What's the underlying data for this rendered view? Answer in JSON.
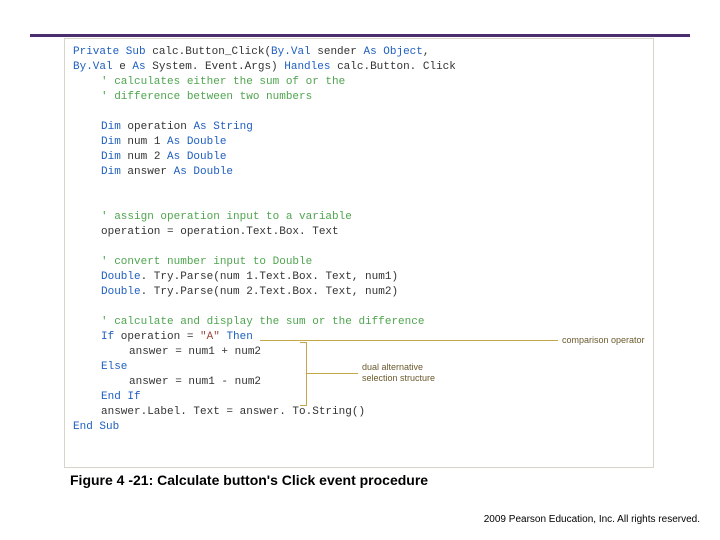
{
  "accent_color": "#4b2e6f",
  "code": {
    "l1a": "Private Sub",
    "l1b": " calc.Button_Click(",
    "l1c": "By.Val",
    "l1d": " sender ",
    "l1e": "As Object",
    "l1f": ",",
    "l2a": "By.Val",
    "l2b": " e ",
    "l2c": "As",
    "l2d": " System. Event.Args) ",
    "l2e": "Handles",
    "l2f": " calc.Button. Click",
    "c1": "' calculates either the sum of or the",
    "c2": "' difference between two numbers",
    "d1a": "Dim",
    "d1b": " operation ",
    "d1c": "As String",
    "d2a": "Dim",
    "d2b": " num 1 ",
    "d2c": "As Double",
    "d3a": "Dim",
    "d3b": " num 2 ",
    "d3c": "As Double",
    "d4a": "Dim",
    "d4b": " answer ",
    "d4c": "As Double",
    "c3": "' assign operation input to a variable",
    "s1": "operation = operation.Text.Box. Text",
    "c4": "' convert number input to Double",
    "s2a": "Double",
    "s2b": ". Try.Parse(num 1.Text.Box. Text, num1)",
    "s3a": "Double",
    "s3b": ". Try.Parse(num 2.Text.Box. Text, num2)",
    "c5": "' calculate and display the sum or the difference",
    "if1a": "If",
    "if1b": " operation = ",
    "if1c": "\"A\"",
    "if1d": " ",
    "if1e": "Then",
    "s4": "answer = num1 + num2",
    "else": "Else",
    "s5": "answer = num1 - num2",
    "endif": "End If",
    "s6": "answer.Label. Text = answer. To.String()",
    "endsub": "End Sub"
  },
  "annotations": {
    "comp_op": "comparison operator",
    "dual_alt1": "dual alternative",
    "dual_alt2": "selection structure"
  },
  "caption": "Figure 4 -21: Calculate button's Click event procedure",
  "copyright": " 2009 Pearson Education, Inc.  All rights reserved."
}
